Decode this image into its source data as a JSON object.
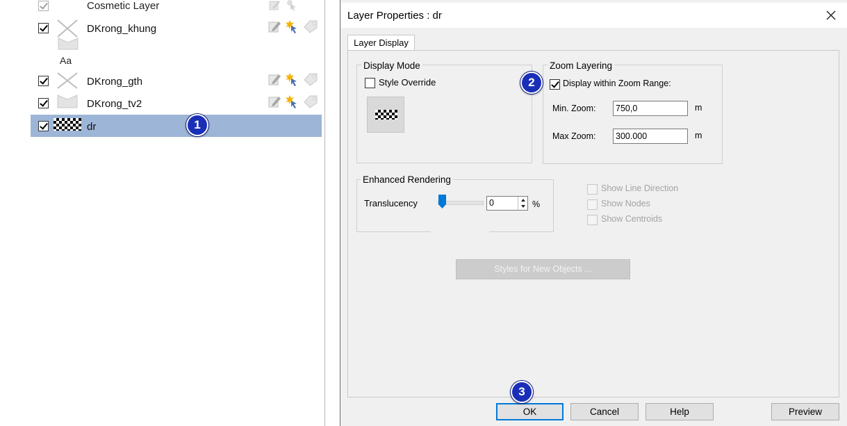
{
  "layers": [
    {
      "name": "Cosmetic Layer",
      "checked": true,
      "dimmed": true
    },
    {
      "name": "DKrong_khung",
      "checked": true
    },
    {
      "sublabel": "Aa"
    },
    {
      "name": "DKrong_gth",
      "checked": true
    },
    {
      "name": "DKrong_tv2",
      "checked": true
    },
    {
      "name": "dr",
      "checked": true,
      "selected": true
    }
  ],
  "icons": {
    "edit": "edit-layer-icon",
    "select": "selectable-icon",
    "label": "label-tag-icon",
    "close": "close-icon"
  },
  "dialog": {
    "title": "Layer Properties  : dr",
    "tab": "Layer Display",
    "display_mode": {
      "title": "Display Mode",
      "style_override_label": "Style Override",
      "style_override_checked": false
    },
    "zoom_layering": {
      "title": "Zoom Layering",
      "display_within_label": "Display within Zoom Range:",
      "display_within_checked": true,
      "min_label": "Min. Zoom:",
      "min_value": "750,0",
      "min_unit": "m",
      "max_label": "Max Zoom:",
      "max_value": "300.000",
      "max_unit": "m"
    },
    "enhanced_rendering": {
      "title": "Enhanced Rendering",
      "translucency_label": "Translucency",
      "translucency_value": "0",
      "translucency_unit": "%"
    },
    "options": [
      {
        "label": "Show Line Direction",
        "enabled": false
      },
      {
        "label": "Show Nodes",
        "enabled": false
      },
      {
        "label": "Show Centroids",
        "enabled": false
      }
    ],
    "styles_button": "Styles for New Objects ...",
    "buttons": {
      "ok": "OK",
      "cancel": "Cancel",
      "help": "Help",
      "preview": "Preview"
    }
  },
  "badges": {
    "one": "1",
    "two": "2",
    "three": "3"
  },
  "colors": {
    "selection": "#9db5d6",
    "badge": "#1a2fb8",
    "default_button_border": "#0078d7"
  }
}
